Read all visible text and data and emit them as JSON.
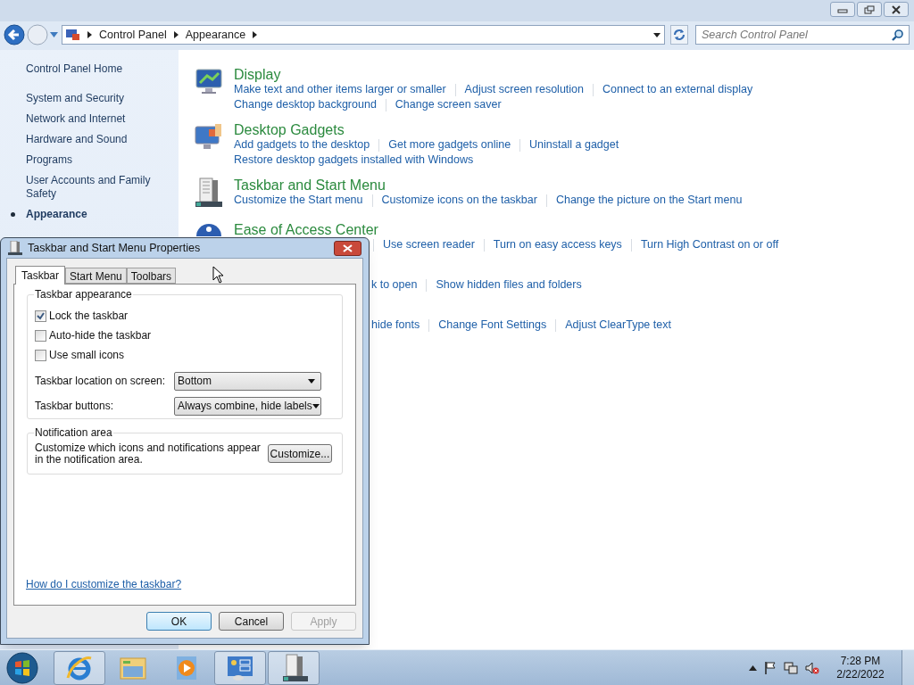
{
  "window": {
    "breadcrumb": [
      "Control Panel",
      "Appearance"
    ],
    "search": {
      "placeholder": "Search Control Panel"
    }
  },
  "sidebar": {
    "home": "Control Panel Home",
    "items": [
      {
        "label": "System and Security",
        "selected": false
      },
      {
        "label": "Network and Internet",
        "selected": false
      },
      {
        "label": "Hardware and Sound",
        "selected": false
      },
      {
        "label": "Programs",
        "selected": false
      },
      {
        "label": "User Accounts and Family Safety",
        "selected": false
      },
      {
        "label": "Appearance",
        "selected": true
      }
    ]
  },
  "sections": [
    {
      "kind": "display",
      "title": "Display",
      "rows": [
        [
          "Make text and other items larger or smaller",
          "Adjust screen resolution",
          "Connect to an external display"
        ],
        [
          "Change desktop background",
          "Change screen saver"
        ]
      ]
    },
    {
      "kind": "gadgets",
      "title": "Desktop Gadgets",
      "rows": [
        [
          "Add gadgets to the desktop",
          "Get more gadgets online",
          "Uninstall a gadget"
        ],
        [
          "Restore desktop gadgets installed with Windows"
        ]
      ]
    },
    {
      "kind": "taskbar",
      "title": "Taskbar and Start Menu",
      "rows": [
        [
          "Customize the Start menu",
          "Customize icons on the taskbar",
          "Change the picture on the Start menu"
        ]
      ]
    },
    {
      "kind": "access",
      "title": "Ease of Access Center",
      "rows": [
        [
          "Use screen reader",
          "Turn on easy access keys",
          "Turn High Contrast on or off"
        ]
      ]
    },
    {
      "kind": "hidden",
      "rows": [
        [
          "k to open",
          "Show hidden files and folders"
        ]
      ]
    },
    {
      "kind": "hidden",
      "rows": [
        [
          "hide fonts",
          "Change Font Settings",
          "Adjust ClearType text"
        ]
      ]
    }
  ],
  "dialog": {
    "title": "Taskbar and Start Menu Properties",
    "tabs": [
      {
        "label": "Taskbar",
        "selected": true
      },
      {
        "label": "Start Menu",
        "selected": false
      },
      {
        "label": "Toolbars",
        "selected": false
      }
    ],
    "appearance": {
      "title": "Taskbar appearance",
      "checkboxes": [
        {
          "label": "Lock the taskbar",
          "checked": true
        },
        {
          "label": "Auto-hide the taskbar",
          "checked": false
        },
        {
          "label": "Use small icons",
          "checked": false
        }
      ],
      "selects": [
        {
          "label": "Taskbar location on screen:",
          "value": "Bottom"
        },
        {
          "label": "Taskbar buttons:",
          "value": "Always combine, hide labels"
        }
      ]
    },
    "notification": {
      "title": "Notification area",
      "text": "Customize which icons and notifications appear in the notification area.",
      "button": "Customize..."
    },
    "help_link": "How do I customize the taskbar?",
    "buttons": [
      {
        "label": "OK",
        "default": true,
        "disabled": false
      },
      {
        "label": "Cancel",
        "default": false,
        "disabled": false
      },
      {
        "label": "Apply",
        "default": false,
        "disabled": true
      }
    ]
  },
  "taskbar": {
    "apps": [
      {
        "kind": "browser",
        "running": true
      },
      {
        "kind": "folder",
        "running": false
      },
      {
        "kind": "media",
        "running": false
      },
      {
        "kind": "control",
        "running": true
      },
      {
        "kind": "properties",
        "running": true
      }
    ],
    "clock": {
      "time": "7:28 PM",
      "date": "2/22/2022"
    }
  }
}
